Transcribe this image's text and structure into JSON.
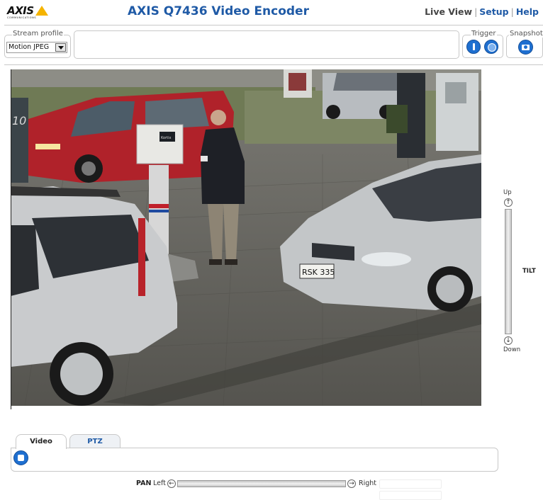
{
  "header": {
    "logo_text": "AXIS",
    "logo_sub": "COMMUNICATIONS",
    "title": "AXIS Q7436 Video Encoder",
    "nav": [
      {
        "label": "Live View"
      },
      {
        "label": "Setup"
      },
      {
        "label": "Help"
      }
    ],
    "nav_sep": "|"
  },
  "toolbar": {
    "stream_profile_label": "Stream profile",
    "stream_profile_value": "Motion JPEG",
    "trigger_label": "Trigger",
    "snapshot_label": "Snapshot"
  },
  "tilt": {
    "up_label": "Up",
    "down_label": "Down",
    "label": "TILT",
    "up_arrow": "↑",
    "down_arrow": "↓"
  },
  "pan": {
    "label": "PAN",
    "left_label": "Left",
    "right_label": "Right",
    "left_arrow": "←",
    "right_arrow": "→"
  },
  "tabs": [
    {
      "label": "Video",
      "active": true
    },
    {
      "label": "PTZ",
      "active": false
    }
  ],
  "video": {
    "sign_number": "10",
    "plate_text": "RSK 335",
    "pole_sign": "Kortix"
  },
  "colors": {
    "brand_blue": "#1f5aa6",
    "icon_blue": "#1e6fd0",
    "logo_yellow": "#f5b400"
  }
}
